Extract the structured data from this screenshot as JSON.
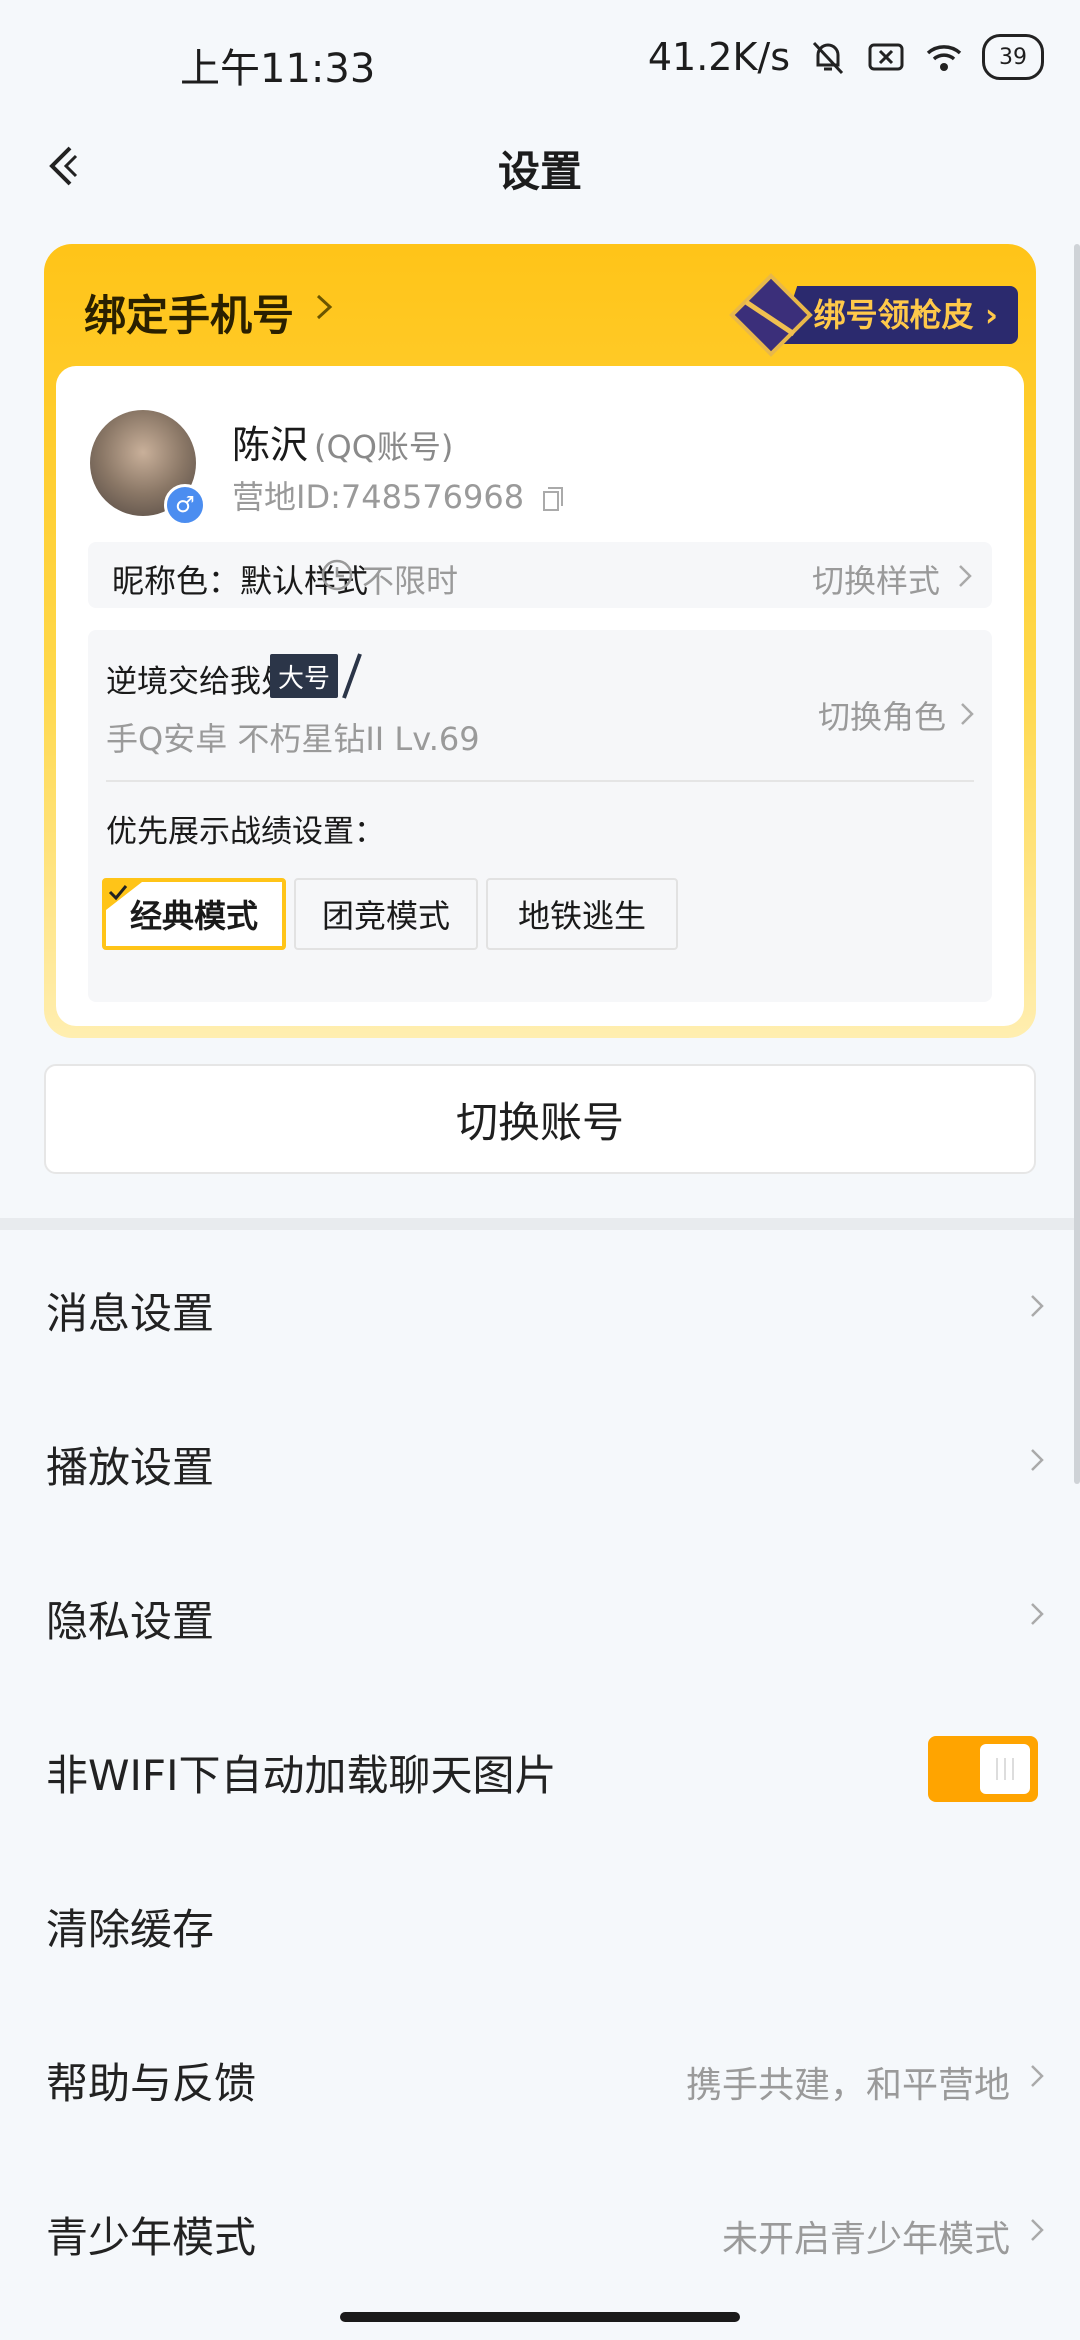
{
  "status_bar": {
    "time": "上午11:33",
    "speed": "41.2K/s",
    "battery": "39"
  },
  "nav": {
    "title": "设置"
  },
  "bind_card": {
    "bind_label": "绑定手机号",
    "promo": "绑号领枪皮",
    "user": {
      "name": "陈沢",
      "account_type": "(QQ账号)",
      "camp_id": "营地ID:748576968"
    },
    "nickname": {
      "label": "昵称色：默认样式",
      "duration": "不限时",
      "action": "切换样式"
    },
    "role": {
      "name": "逆境交给我处理",
      "badge": "大号",
      "sub": "手Q安卓  不朽星钻II  Lv.69",
      "action": "切换角色",
      "priority_label": "优先展示战绩设置：",
      "modes": [
        {
          "label": "经典模式",
          "active": true
        },
        {
          "label": "团竞模式",
          "active": false
        },
        {
          "label": "地铁逃生",
          "active": false
        }
      ]
    }
  },
  "switch_account": "切换账号",
  "settings": [
    {
      "label": "消息设置",
      "value": "",
      "type": "chevron"
    },
    {
      "label": "播放设置",
      "value": "",
      "type": "chevron"
    },
    {
      "label": "隐私设置",
      "value": "",
      "type": "chevron"
    },
    {
      "label": "非WIFI下自动加载聊天图片",
      "value": "",
      "type": "toggle",
      "on": true
    },
    {
      "label": "清除缓存",
      "value": "",
      "type": "none"
    },
    {
      "label": "帮助与反馈",
      "value": "携手共建，和平营地",
      "type": "chevron"
    },
    {
      "label": "青少年模式",
      "value": "未开启青少年模式",
      "type": "chevron"
    }
  ],
  "colors": {
    "accent": "#ffc418",
    "toggle_on": "#ffa400",
    "promo_bg": "#2b2a6e"
  }
}
